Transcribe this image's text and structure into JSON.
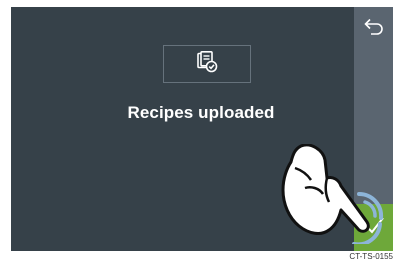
{
  "screen": {
    "message": "Recipes uploaded",
    "message_icon": "recipe-upload-icon"
  },
  "side_panel": {
    "back_icon": "back-arrow-icon",
    "confirm_icon": "checkmark-icon"
  },
  "overlay": {
    "pointer_icon": "pointing-hand-icon"
  },
  "footer": {
    "code": "CT-TS-0155"
  },
  "colors": {
    "screen_background": "#364149",
    "side_panel": "#5a6570",
    "confirm": "#6ea83a",
    "text": "#ffffff"
  }
}
